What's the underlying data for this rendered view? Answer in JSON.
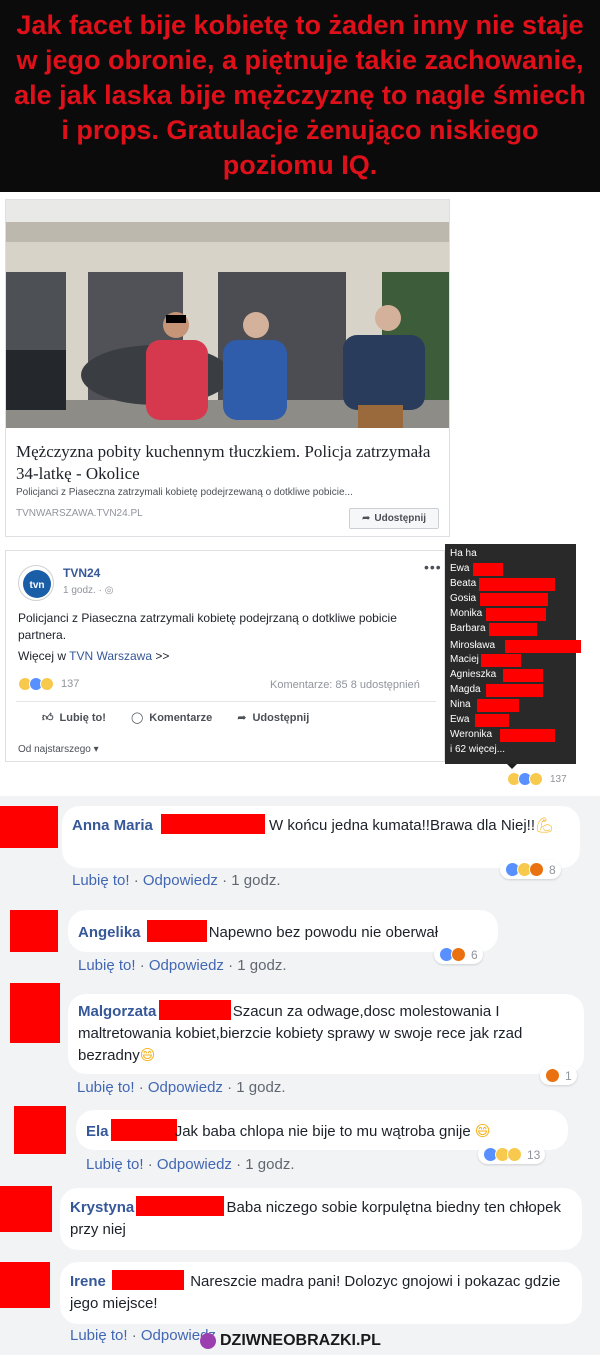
{
  "banner": {
    "text": "Jak facet bije kobietę to żaden inny nie staje w jego obronie, a piętnuje takie zachowanie, ale jak laska bije mężczyznę to nagle śmiech i props. Gratulacje żenująco niskiego poziomu IQ."
  },
  "preview": {
    "title": "Mężczyzna pobity kuchennym tłuczkiem. Policja zatrzymała 34-latkę - Okolice",
    "description": "Policjanci z Piaseczna zatrzymali kobietę podejrzewaną o dotkliwe pobicie...",
    "domain": "TVNWARSZAWA.TVN24.PL",
    "share_label": "Udostępnij"
  },
  "post": {
    "page_name": "TVN24",
    "time": "1 godz. · ",
    "body": "Policjanci z Piaseczna zatrzymali kobietę podejrzaną o dotkliwe pobicie partnera.",
    "more_prefix": "Więcej w ",
    "more_link": "TVN Warszawa",
    "more_suffix": " >>",
    "reaction_count": "137",
    "stats": "Komentarze: 85  8 udostępnień",
    "actions": {
      "like": "Lubię to!",
      "comment": "Komentarze",
      "share": "Udostępnij"
    },
    "sort_label": "Od najstarszego ▾"
  },
  "tooltip": {
    "title": "Ha ha",
    "names": [
      "Ewa",
      "Beata",
      "Gosia",
      "Monika",
      "Barbara",
      "Mirosława",
      "Maciej",
      "Agnieszka",
      "Magda",
      "Nina",
      "Ewa",
      "Weronika"
    ],
    "more": "i 62 więcej...",
    "count": "137"
  },
  "comments": [
    {
      "name": "Anna Maria",
      "text": "W końcu jedna kumata!!Brawa dla Niej!!",
      "like": "Lubię to!",
      "reply": "Odpowiedz",
      "time": "1 godz.",
      "reactions": "8"
    },
    {
      "name": "Angelika",
      "text": "Napewno bez powodu nie oberwał",
      "like": "Lubię to!",
      "reply": "Odpowiedz",
      "time": "1 godz.",
      "reactions": "6"
    },
    {
      "name": "Malgorzata",
      "text": "Szacun za odwage,dosc molestowania I maltretowania kobiet,bierzcie kobiety sprawy w swoje rece jak rzad bezradny",
      "like": "Lubię to!",
      "reply": "Odpowiedz",
      "time": "1 godz.",
      "reactions": "1"
    },
    {
      "name": "Ela",
      "text": "Jak baba chlopa nie bije to mu wątroba gnije",
      "like": "Lubię to!",
      "reply": "Odpowiedz",
      "time": "1 godz.",
      "reactions": "13"
    },
    {
      "name": "Krystyna",
      "text": "Baba niczego sobie korpulętna biedny ten chłopek przy niej"
    },
    {
      "name": "Irene",
      "text": "Nareszcie madra pani! Dolozyc gnojowi i pokazac gdzie jego miejsce!",
      "like": "Lubię to!",
      "reply": "Odpowiedz"
    }
  ],
  "watermark": "DZIWNEOBRAZKI.PL"
}
